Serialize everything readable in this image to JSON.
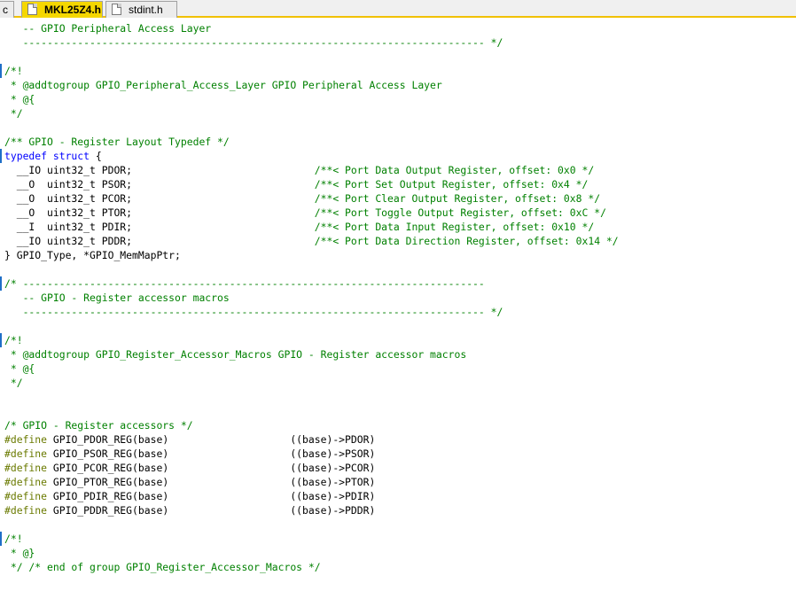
{
  "tabs": [
    {
      "label": "c"
    },
    {
      "label": "MKL25Z4.h",
      "active": true,
      "icon": "file-icon"
    },
    {
      "label": "stdint.h",
      "icon": "file-icon"
    }
  ],
  "colors": {
    "comment": "#008000",
    "keyword": "#0000ff",
    "preprocessor": "#6a7a00",
    "active_tab": "#f5d700"
  },
  "code": {
    "l01": "   -- GPIO Peripheral Access Layer",
    "l02": "   ---------------------------------------------------------------------------- */",
    "l03": "/*!",
    "l04": " * @addtogroup GPIO_Peripheral_Access_Layer GPIO Peripheral Access Layer",
    "l05": " * @{",
    "l06": " */",
    "l07": "/** GPIO - Register Layout Typedef */",
    "l08_kw": "typedef struct",
    "l08_rest": " {",
    "r1_code": "  __IO uint32_t PDOR;                              ",
    "r1_com": "/**< Port Data Output Register, offset: 0x0 */",
    "r2_code": "  __O  uint32_t PSOR;                              ",
    "r2_com": "/**< Port Set Output Register, offset: 0x4 */",
    "r3_code": "  __O  uint32_t PCOR;                              ",
    "r3_com": "/**< Port Clear Output Register, offset: 0x8 */",
    "r4_code": "  __O  uint32_t PTOR;                              ",
    "r4_com": "/**< Port Toggle Output Register, offset: 0xC */",
    "r5_code": "  __I  uint32_t PDIR;                              ",
    "r5_com": "/**< Port Data Input Register, offset: 0x10 */",
    "r6_code": "  __IO uint32_t PDDR;                              ",
    "r6_com": "/**< Port Data Direction Register, offset: 0x14 */",
    "l15": "} GPIO_Type, *GPIO_MemMapPtr;",
    "l16": "/* ----------------------------------------------------------------------------",
    "l17": "   -- GPIO - Register accessor macros",
    "l18": "   ---------------------------------------------------------------------------- */",
    "l19": "/*!",
    "l20": " * @addtogroup GPIO_Register_Accessor_Macros GPIO - Register accessor macros",
    "l21": " * @{",
    "l22": " */",
    "l23": "/* GPIO - Register accessors */",
    "d1_pp": "#define",
    "d1_rest": " GPIO_PDOR_REG(base)                    ((base)->PDOR)",
    "d2_pp": "#define",
    "d2_rest": " GPIO_PSOR_REG(base)                    ((base)->PSOR)",
    "d3_pp": "#define",
    "d3_rest": " GPIO_PCOR_REG(base)                    ((base)->PCOR)",
    "d4_pp": "#define",
    "d4_rest": " GPIO_PTOR_REG(base)                    ((base)->PTOR)",
    "d5_pp": "#define",
    "d5_rest": " GPIO_PDIR_REG(base)                    ((base)->PDIR)",
    "d6_pp": "#define",
    "d6_rest": " GPIO_PDDR_REG(base)                    ((base)->PDDR)",
    "l30": "/*!",
    "l31": " * @}",
    "l32": " */ /* end of group GPIO_Register_Accessor_Macros */"
  }
}
